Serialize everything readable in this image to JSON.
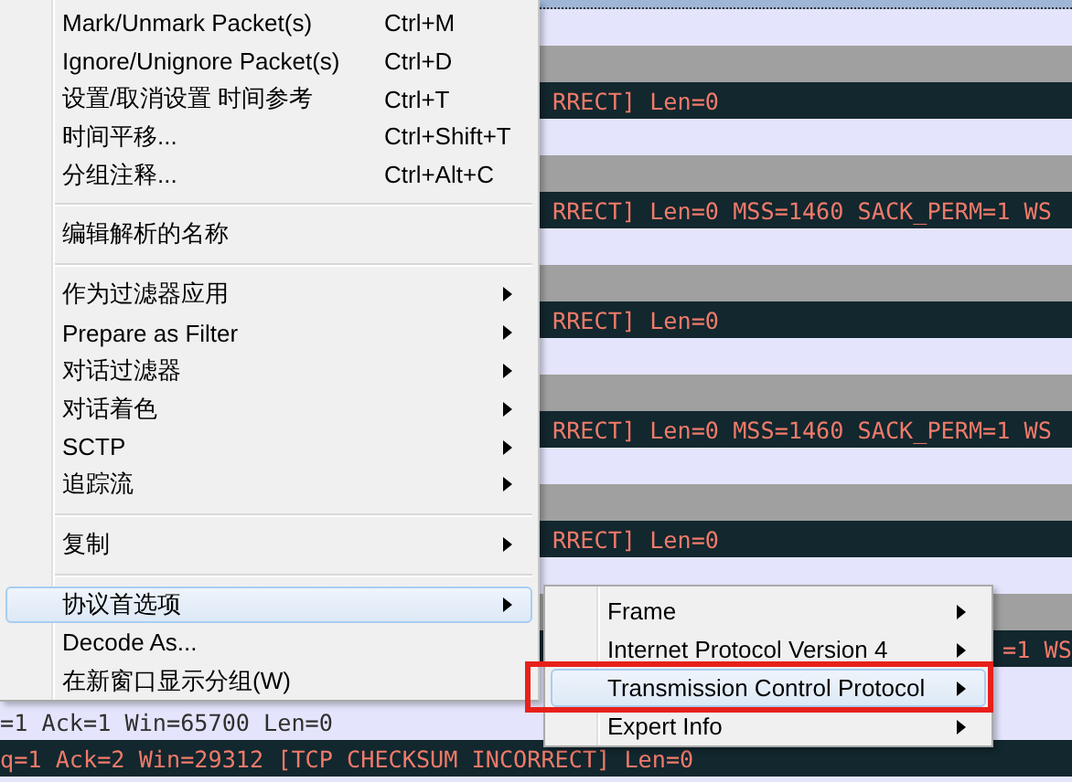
{
  "packet_list": {
    "rows": [
      {
        "selected": true,
        "text": ""
      },
      {
        "kind": "light",
        "selected": false,
        "text": ""
      },
      {
        "kind": "gray",
        "selected": false,
        "text": ""
      },
      {
        "kind": "dark",
        "selected": false,
        "text": "RRECT] Len=0"
      },
      {
        "kind": "light",
        "selected": false,
        "text": ""
      },
      {
        "kind": "gray",
        "selected": false,
        "text": ""
      },
      {
        "kind": "dark",
        "selected": false,
        "text": "RRECT] Len=0 MSS=1460 SACK_PERM=1 WS"
      },
      {
        "kind": "light",
        "selected": false,
        "text": ""
      },
      {
        "kind": "gray",
        "selected": false,
        "text": ""
      },
      {
        "kind": "dark",
        "selected": false,
        "text": "RRECT] Len=0"
      },
      {
        "kind": "light",
        "selected": false,
        "text": ""
      },
      {
        "kind": "gray",
        "selected": false,
        "text": ""
      },
      {
        "kind": "dark",
        "selected": false,
        "text": "RRECT] Len=0 MSS=1460 SACK_PERM=1 WS"
      },
      {
        "kind": "light",
        "selected": false,
        "text": ""
      },
      {
        "kind": "gray",
        "selected": false,
        "text": ""
      },
      {
        "kind": "dark",
        "selected": false,
        "text": "RRECT] Len=0"
      },
      {
        "kind": "light",
        "selected": false,
        "text": ""
      },
      {
        "kind": "gray",
        "selected": false,
        "text": ""
      },
      {
        "kind": "dark",
        "selected": false,
        "text": "=1 WS"
      },
      {
        "kind": "light",
        "selected": false,
        "text": ""
      },
      {
        "kind": "light",
        "selected": false,
        "text": "=1 Ack=1 Win=65700 Len=0"
      },
      {
        "kind": "dark",
        "selected": false,
        "text": "q=1 Ack=2 Win=29312 [TCP CHECKSUM INCORRECT] Len=0"
      },
      {
        "kind": "light",
        "selected": false,
        "text": ""
      }
    ]
  },
  "context_menu": {
    "items": [
      {
        "kind": "item",
        "label": "Mark/Unmark Packet(s)",
        "shortcut": "Ctrl+M",
        "submenu": false,
        "selected": false
      },
      {
        "kind": "item",
        "label": "Ignore/Unignore Packet(s)",
        "shortcut": "Ctrl+D",
        "submenu": false,
        "selected": false
      },
      {
        "kind": "item",
        "label": "设置/取消设置 时间参考",
        "shortcut": "Ctrl+T",
        "submenu": false,
        "selected": false
      },
      {
        "kind": "item",
        "label": "时间平移...",
        "shortcut": "Ctrl+Shift+T",
        "submenu": false,
        "selected": false
      },
      {
        "kind": "item",
        "label": "分组注释...",
        "shortcut": "Ctrl+Alt+C",
        "submenu": false,
        "selected": false
      },
      {
        "kind": "separator"
      },
      {
        "kind": "item",
        "label": "编辑解析的名称",
        "submenu": false,
        "selected": false
      },
      {
        "kind": "separator"
      },
      {
        "kind": "item",
        "label": "作为过滤器应用",
        "submenu": true,
        "selected": false
      },
      {
        "kind": "item",
        "label": "Prepare as Filter",
        "submenu": true,
        "selected": false
      },
      {
        "kind": "item",
        "label": "对话过滤器",
        "submenu": true,
        "selected": false
      },
      {
        "kind": "item",
        "label": "对话着色",
        "submenu": true,
        "selected": false
      },
      {
        "kind": "item",
        "label": "SCTP",
        "submenu": true,
        "selected": false
      },
      {
        "kind": "item",
        "label": "追踪流",
        "submenu": true,
        "selected": false
      },
      {
        "kind": "separator"
      },
      {
        "kind": "item",
        "label": "复制",
        "submenu": true,
        "selected": false
      },
      {
        "kind": "separator"
      },
      {
        "kind": "item",
        "label": "协议首选项",
        "submenu": true,
        "selected": true
      },
      {
        "kind": "item",
        "label": "Decode As...",
        "submenu": false,
        "selected": false
      },
      {
        "kind": "item",
        "label": "在新窗口显示分组(W)",
        "submenu": false,
        "selected": false
      }
    ]
  },
  "submenu": {
    "items": [
      {
        "label": "Frame",
        "submenu": true,
        "selected": false
      },
      {
        "label": "Internet Protocol Version 4",
        "submenu": true,
        "selected": false
      },
      {
        "label": "Transmission Control Protocol",
        "submenu": true,
        "selected": true
      },
      {
        "label": "Expert Info",
        "submenu": true,
        "selected": false
      }
    ]
  },
  "annotation": {
    "highlight": true
  }
}
